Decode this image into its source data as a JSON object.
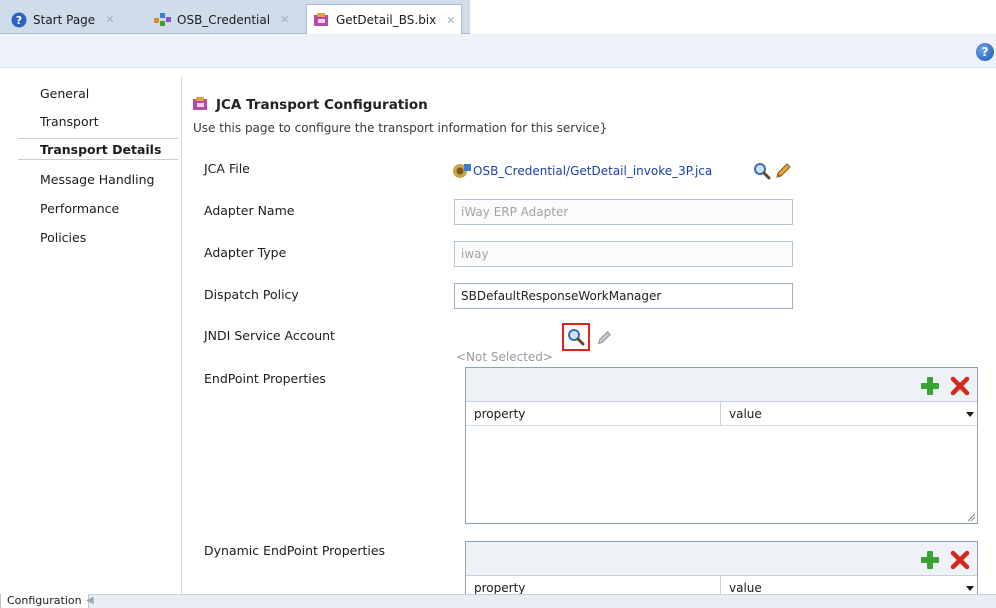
{
  "tabs": [
    {
      "label": "Start Page",
      "icon": "help-circle-icon"
    },
    {
      "label": "OSB_Credential",
      "icon": "project-icon"
    },
    {
      "label": "GetDetail_BS.bix",
      "icon": "business-service-icon"
    }
  ],
  "nav": {
    "items": [
      "General",
      "Transport",
      "Transport Details",
      "Message Handling",
      "Performance",
      "Policies"
    ],
    "selected": "Transport Details"
  },
  "main": {
    "title": "JCA Transport Configuration",
    "subtitle": "Use this page to configure the transport information for this service}",
    "jca_file_label": "JCA File",
    "jca_file_value": "OSB_Credential/GetDetail_invoke_3P.jca",
    "adapter_name_label": "Adapter Name",
    "adapter_name_value": "iWay ERP Adapter",
    "adapter_type_label": "Adapter Type",
    "adapter_type_value": "iway",
    "dispatch_policy_label": "Dispatch Policy",
    "dispatch_policy_value": "SBDefaultResponseWorkManager",
    "jndi_label": "JNDI Service Account",
    "jndi_value": "<Not Selected>",
    "endpoint_label": "EndPoint Properties",
    "dynamic_endpoint_label": "Dynamic EndPoint Properties",
    "col_property": "property",
    "col_value": "value"
  },
  "bottom": {
    "tab": "Configuration"
  },
  "colors": {
    "accent_red": "#e2231a",
    "link_blue": "#1a3fa8",
    "add_green": "#3aa336"
  }
}
